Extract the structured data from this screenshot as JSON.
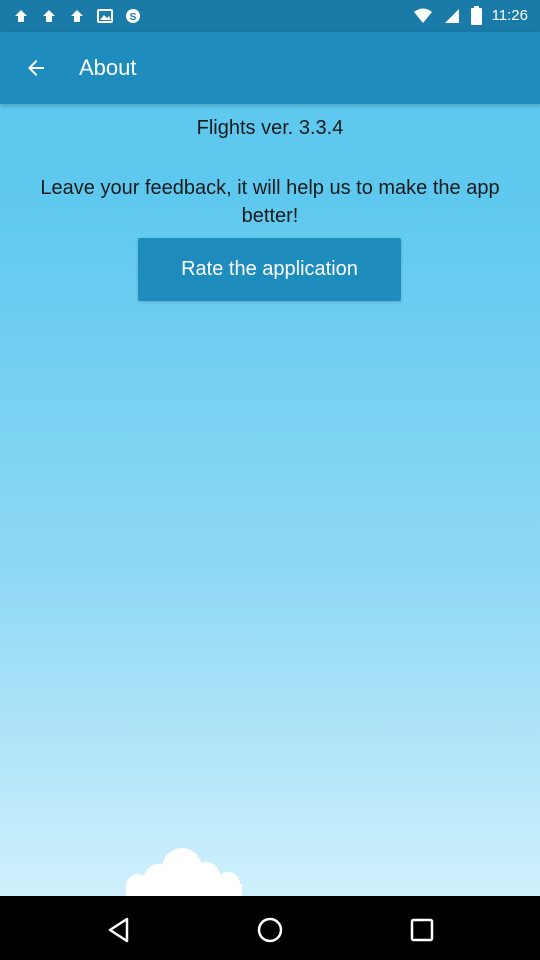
{
  "status_bar": {
    "time": "11:26",
    "icons": [
      "notification-icon",
      "notification-icon",
      "notification-icon",
      "photo-icon",
      "skype-icon",
      "wifi-icon",
      "signal-icon",
      "battery-icon"
    ]
  },
  "app_bar": {
    "title": "About",
    "back_icon": "back-arrow-icon"
  },
  "content": {
    "version_text": "Flights ver. 3.3.4",
    "feedback_text": "Leave your feedback, it will help us to make the app better!",
    "rate_button_label": "Rate the application"
  },
  "nav_bar": {
    "buttons": [
      "back-triangle-icon",
      "home-circle-icon",
      "recents-square-icon"
    ]
  },
  "colors": {
    "status_bar": "#1a7aa8",
    "app_bar": "#1e8cbc",
    "button": "#1e8cbc",
    "background_top": "#5ec8ee",
    "background_bottom": "#d8f3fd"
  }
}
